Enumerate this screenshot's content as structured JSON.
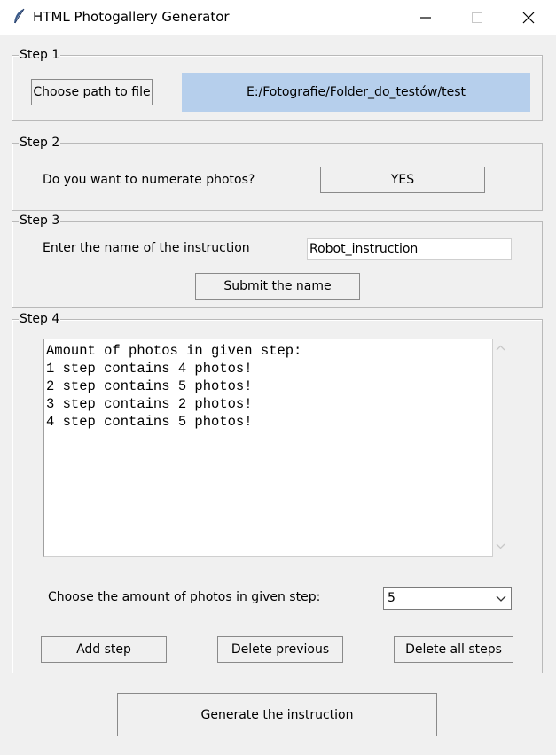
{
  "window": {
    "title": "HTML Photogallery Generator"
  },
  "step1": {
    "label": "Step 1",
    "choose_button": "Choose path to file",
    "path_value": "E:/Fotografie/Folder_do_testów/test"
  },
  "step2": {
    "label": "Step 2",
    "question": "Do you want to numerate photos?",
    "toggle_button": "YES"
  },
  "step3": {
    "label": "Step 3",
    "prompt": "Enter the name of the instruction",
    "name_value": "Robot_instruction",
    "submit_button": "Submit the name"
  },
  "step4": {
    "label": "Step 4",
    "output_lines": [
      "Amount of photos in given step:",
      "1 step contains 4 photos!",
      "2 step contains 5 photos!",
      "3 step contains 2 photos!",
      "4 step contains 5 photos!"
    ],
    "amount_prompt": "Choose the amount of photos in given step:",
    "amount_selected": "5",
    "add_button": "Add step",
    "delete_prev_button": "Delete previous",
    "delete_all_button": "Delete all steps"
  },
  "generate_button": "Generate the instruction",
  "colors": {
    "path_background": "#b6cfec",
    "window_background": "#f0f0f0"
  }
}
